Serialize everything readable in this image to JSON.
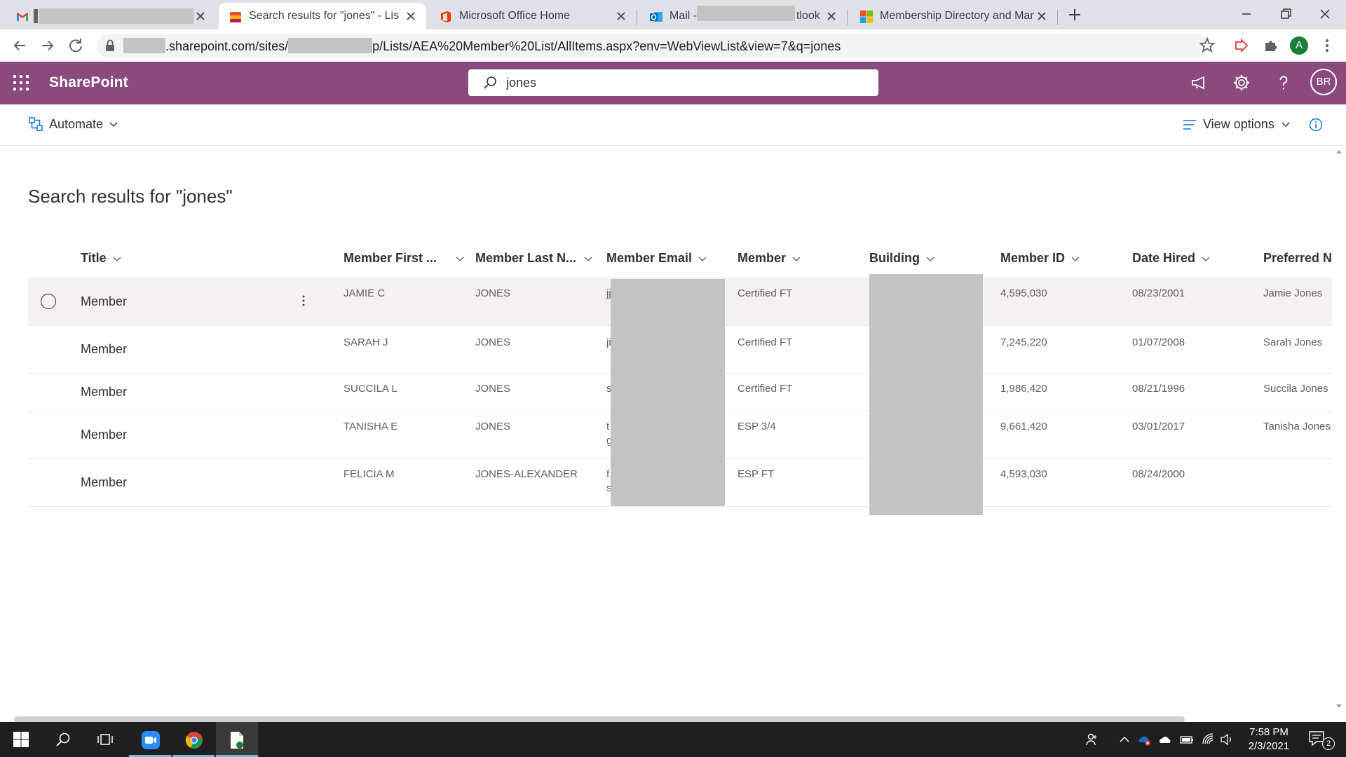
{
  "browser": {
    "tabs": [
      {
        "title": "",
        "icon": "gmail-icon"
      },
      {
        "title": "Search results for \"jones\" - Lists",
        "icon": "lists-icon",
        "active": true
      },
      {
        "title": "Microsoft Office Home",
        "icon": "office-icon"
      },
      {
        "title_prefix": "Mail - ",
        "title_suffix": "tlook",
        "icon": "outlook-icon"
      },
      {
        "title": "Membership Directory and Mana",
        "icon": "microsoft-icon"
      }
    ],
    "url_prefix": ".sharepoint.com/sites/",
    "url_mid": "p/Lists/AEA%20Member%20List/AllItems.aspx?env=WebViewList&view=7&q=jones",
    "profile_initial": "A"
  },
  "suite": {
    "brand": "SharePoint",
    "search_value": "jones",
    "user_initials": "BR",
    "color": "#8a4a7d"
  },
  "command_bar": {
    "automate_label": "Automate",
    "view_options_label": "View options"
  },
  "page": {
    "title": "Search results for \"jones\""
  },
  "columns": [
    "Title",
    "Member First ...",
    "Member Last N...",
    "Member Email",
    "Member",
    "Building",
    "Member ID",
    "Date Hired",
    "Preferred Na"
  ],
  "rows": [
    {
      "title": "Member",
      "first": "JAMIE C",
      "last": "JONES",
      "email_1": "jj",
      "email_2": "",
      "member": "Certified FT",
      "building": "",
      "id": "4,595,030",
      "hired": "08/23/2001",
      "preferred": "Jamie Jones"
    },
    {
      "title": "Member",
      "first": "SARAH J",
      "last": "JONES",
      "email_1": "ji",
      "email_2": "",
      "member": "Certified FT",
      "building": "",
      "id": "7,245,220",
      "hired": "01/07/2008",
      "preferred": "Sarah Jones"
    },
    {
      "title": "Member",
      "first": "SUCCILA L",
      "last": "JONES",
      "email_1": "s",
      "email_2": "",
      "member": "Certified FT",
      "building": "",
      "id": "1,986,420",
      "hired": "08/21/1996",
      "preferred": "Succila Jones"
    },
    {
      "title": "Member",
      "first": "TANISHA E",
      "last": "JONES",
      "email_1": "t",
      "email_2": "g",
      "member": "ESP 3/4",
      "building": "",
      "id": "9,661,420",
      "hired": "03/01/2017",
      "preferred": "Tanisha Jones"
    },
    {
      "title": "Member",
      "first": "FELICIA M",
      "last": "JONES-ALEXANDER",
      "email_1": "f",
      "email_2": "s",
      "member": "ESP FT",
      "building": "",
      "id": "4,593,030",
      "hired": "08/24/2000",
      "preferred": ""
    }
  ],
  "taskbar": {
    "time": "7:58 PM",
    "date": "2/3/2021",
    "notification_count": "2"
  }
}
